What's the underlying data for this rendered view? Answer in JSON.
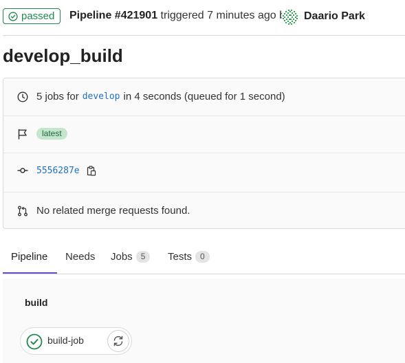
{
  "header": {
    "status": "passed",
    "pipeline_label": "Pipeline #421901",
    "triggered_text": "triggered 7 minutes ago by",
    "author": "Daario Park"
  },
  "page_title": "develop_build",
  "info": {
    "jobs_prefix": "5 jobs for",
    "branch": "develop",
    "jobs_suffix": "in 4 seconds (queued for 1 second)",
    "latest_badge": "latest",
    "commit_sha": "5556287e",
    "merge_requests_text": "No related merge requests found."
  },
  "tabs": [
    {
      "label": "Pipeline",
      "count": null,
      "active": true
    },
    {
      "label": "Needs",
      "count": null,
      "active": false
    },
    {
      "label": "Jobs",
      "count": "5",
      "active": false
    },
    {
      "label": "Tests",
      "count": "0",
      "active": false
    }
  ],
  "graph": {
    "stage": "build",
    "job": "build-job"
  },
  "colors": {
    "success": "#1f8a4c",
    "link": "#1f6fc5",
    "tab_active_underline": "#6e49cb"
  },
  "icons": {
    "status": "check-circle-icon",
    "clock": "clock-icon",
    "flag": "flag-icon",
    "commit": "commit-icon",
    "copy": "copy-icon",
    "merge_request": "merge-request-icon",
    "retry": "retry-icon"
  }
}
